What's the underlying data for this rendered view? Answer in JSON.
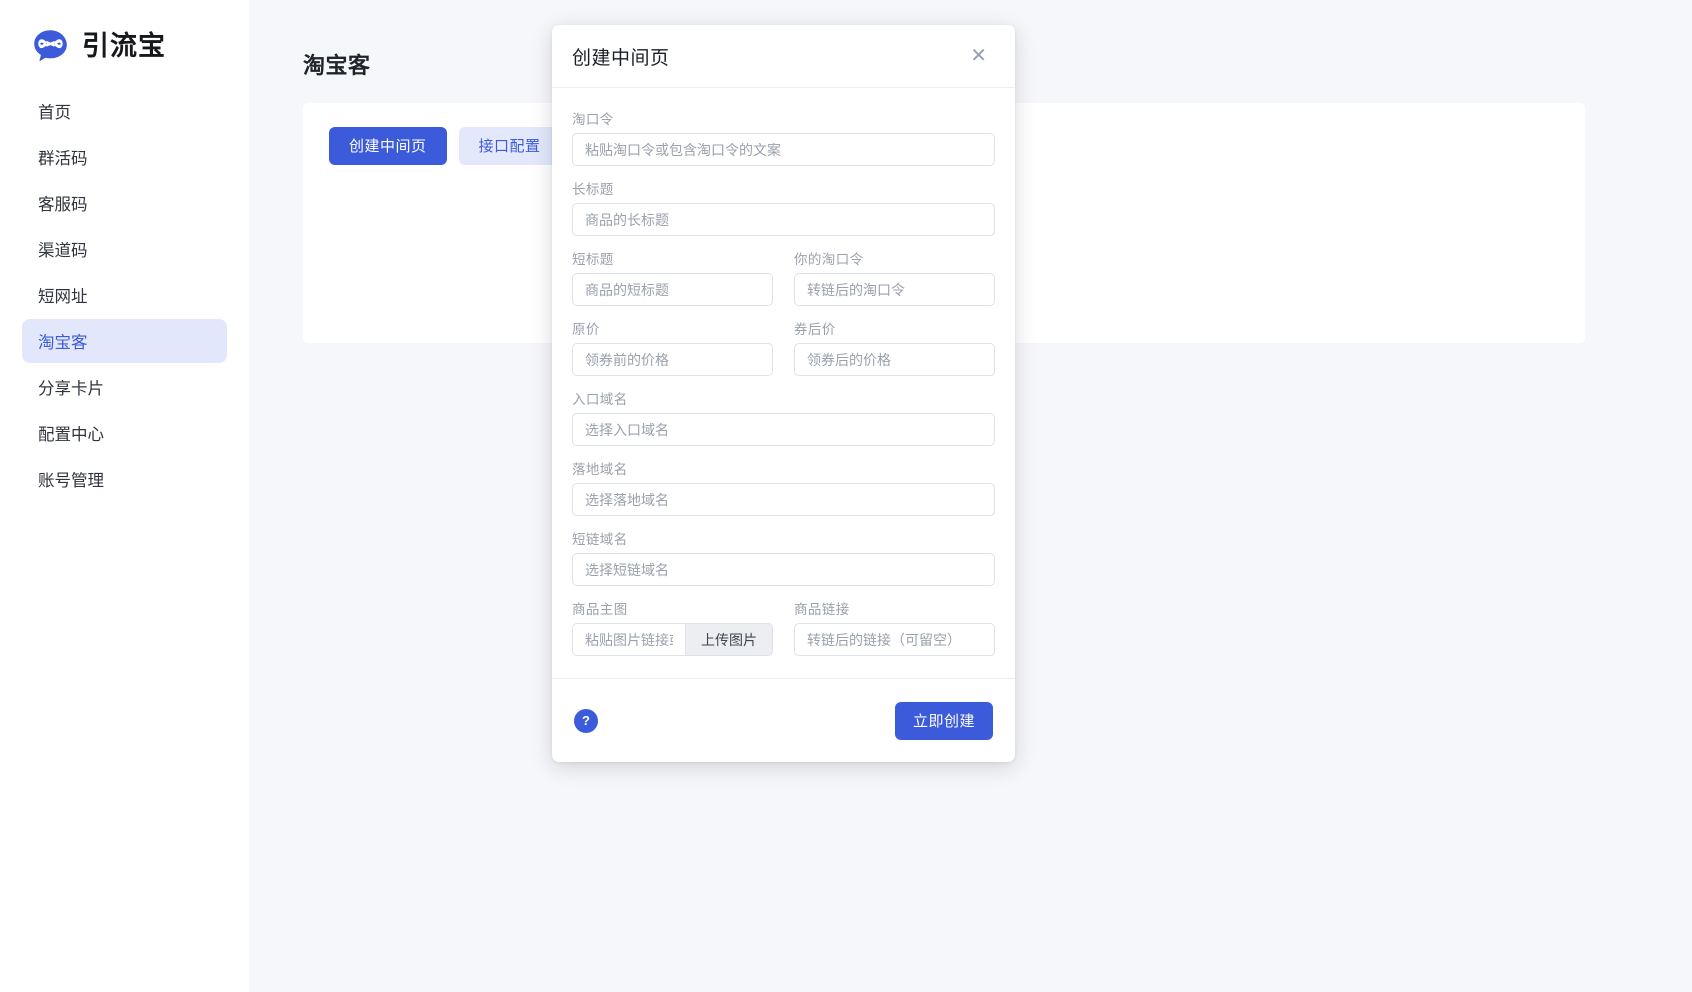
{
  "brand": {
    "name": "引流宝",
    "logo_icon": "speech-bubble-infinity-logo",
    "accent_color": "#3b5bdb"
  },
  "sidebar": {
    "items": [
      {
        "label": "首页",
        "active": false
      },
      {
        "label": "群活码",
        "active": false
      },
      {
        "label": "客服码",
        "active": false
      },
      {
        "label": "渠道码",
        "active": false
      },
      {
        "label": "短网址",
        "active": false
      },
      {
        "label": "淘宝客",
        "active": true
      },
      {
        "label": "分享卡片",
        "active": false
      },
      {
        "label": "配置中心",
        "active": false
      },
      {
        "label": "账号管理",
        "active": false
      }
    ]
  },
  "main": {
    "page_title": "淘宝客",
    "tabs": [
      {
        "label": "创建中间页",
        "style": "primary"
      },
      {
        "label": "接口配置",
        "style": "ghost"
      }
    ]
  },
  "modal": {
    "title": "创建中间页",
    "close_icon": "close-icon",
    "fields": {
      "taokouling": {
        "label": "淘口令",
        "placeholder": "粘贴淘口令或包含淘口令的文案",
        "value": ""
      },
      "long_title": {
        "label": "长标题",
        "placeholder": "商品的长标题",
        "value": ""
      },
      "short_title": {
        "label": "短标题",
        "placeholder": "商品的短标题",
        "value": ""
      },
      "your_taokouling": {
        "label": "你的淘口令",
        "placeholder": "转链后的淘口令",
        "value": ""
      },
      "original_price": {
        "label": "原价",
        "placeholder": "领券前的价格",
        "value": ""
      },
      "coupon_price": {
        "label": "券后价",
        "placeholder": "领券后的价格",
        "value": ""
      },
      "entry_domain": {
        "label": "入口域名",
        "placeholder": "选择入口域名",
        "value": ""
      },
      "landing_domain": {
        "label": "落地域名",
        "placeholder": "选择落地域名",
        "value": ""
      },
      "short_domain": {
        "label": "短链域名",
        "placeholder": "选择短链域名",
        "value": ""
      },
      "main_image": {
        "label": "商品主图",
        "placeholder": "粘贴图片链接或上传",
        "value": "",
        "upload_button": "上传图片"
      },
      "product_link": {
        "label": "商品链接",
        "placeholder": "转链后的链接（可留空）",
        "value": ""
      }
    },
    "footer": {
      "help_label": "?",
      "help_icon": "question-mark-icon",
      "submit_label": "立即创建"
    }
  }
}
